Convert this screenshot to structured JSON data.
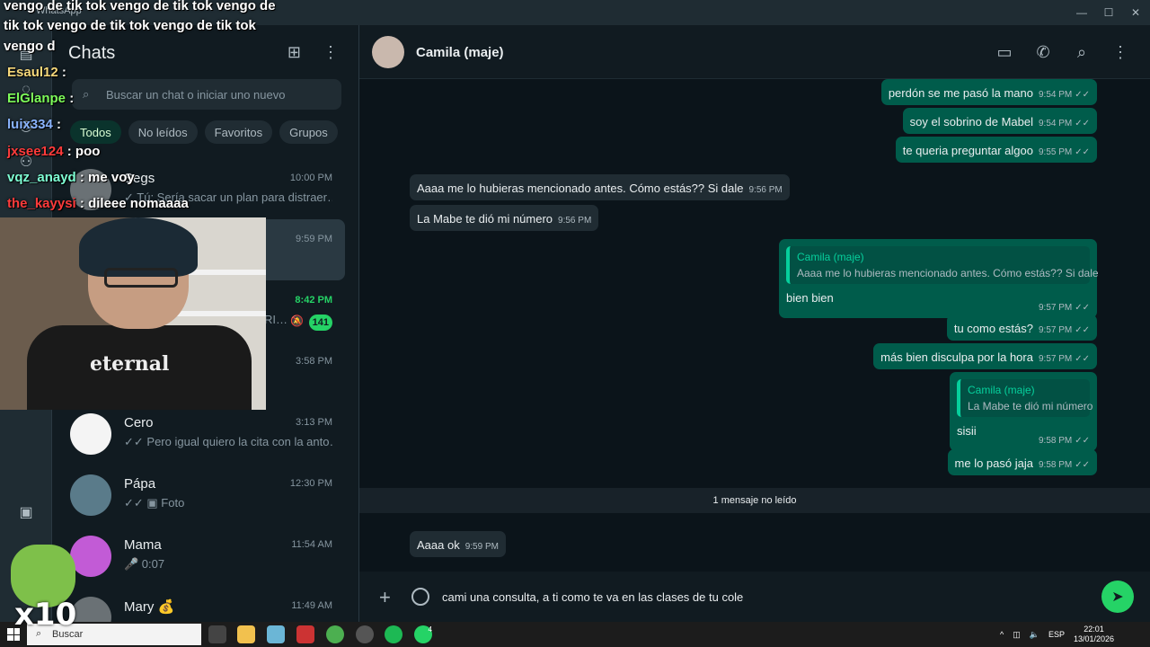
{
  "titlebar": {
    "app_name": "WhatsApp",
    "minimize": "—",
    "maximize": "☐",
    "close": "✕"
  },
  "chatlist": {
    "title": "Chats",
    "search_placeholder": "Buscar un chat o iniciar uno nuevo",
    "filters": [
      "Todos",
      "No leídos",
      "Favoritos",
      "Grupos"
    ],
    "items": [
      {
        "name": "Segs",
        "time": "10:00 PM",
        "preview": "✓ Tú: Sería sacar un plan para distraer…"
      },
      {
        "name": "",
        "time": "9:59 PM",
        "preview": ""
      },
      {
        "name": "",
        "time": "8:42 PM",
        "preview": "RI…",
        "badge": "141"
      },
      {
        "name": "",
        "time": "3:58 PM",
        "preview": ""
      },
      {
        "name": "Cero",
        "time": "3:13 PM",
        "preview": "✓✓ Pero igual quiero la cita con la anto…"
      },
      {
        "name": "Pápa",
        "time": "12:30 PM",
        "preview": "✓✓ ▣ Foto"
      },
      {
        "name": "Mama",
        "time": "11:54 AM",
        "preview": "🎤 0:07"
      },
      {
        "name": "Mary 💰",
        "time": "11:49 AM",
        "preview": ""
      }
    ]
  },
  "conversation": {
    "contact_name": "Camila (maje)",
    "messages": [
      {
        "dir": "out",
        "text": "perdón se me pasó la mano",
        "time": "9:54 PM"
      },
      {
        "dir": "out",
        "text": "soy el sobrino de Mabel",
        "time": "9:54 PM"
      },
      {
        "dir": "out",
        "text": "te queria preguntar algoo",
        "time": "9:55 PM"
      },
      {
        "dir": "in",
        "text": "Aaaa me lo hubieras mencionado antes. Cómo estás?? Si dale",
        "time": "9:56 PM"
      },
      {
        "dir": "in",
        "text": "La Mabe te dió mi número",
        "time": "9:56 PM"
      },
      {
        "dir": "out",
        "quote_name": "Camila (maje)",
        "quote_text": "Aaaa me lo hubieras mencionado antes. Cómo estás?? Si dale",
        "text": "bien bien",
        "time": "9:57 PM"
      },
      {
        "dir": "out",
        "text": "tu como estás?",
        "time": "9:57 PM"
      },
      {
        "dir": "out",
        "text": "más bien disculpa por la hora",
        "time": "9:57 PM"
      },
      {
        "dir": "out",
        "quote_name": "Camila (maje)",
        "quote_text": "La Mabe te dió mi número",
        "text": "sisii",
        "time": "9:58 PM"
      },
      {
        "dir": "out",
        "text": "me lo pasó jaja",
        "time": "9:58 PM"
      },
      {
        "dir": "in",
        "text": "Aaaa ok",
        "time": "9:59 PM"
      }
    ],
    "unread_divider": "1 mensaje no leído",
    "composer_text": "cami una consulta, a ti como te va en las clases de tu cole",
    "ticks": "✓✓"
  },
  "taskbar": {
    "search_label": "Buscar",
    "lang": "ESP",
    "clock_time": "22:01",
    "clock_date": "13/01/2026",
    "whatsapp_badge": "4"
  },
  "overlay": {
    "banner_lines": [
      "vengo de tik tok vengo de tik tok vengo de",
      "tik tok vengo de tik tok vengo de tik tok",
      "vengo d"
    ],
    "chat": [
      {
        "user": "Esaul12",
        "msg": "",
        "color": "#f5d77a"
      },
      {
        "user": "ElGlanpe",
        "msg": "",
        "color": "#7dfc5a"
      },
      {
        "user": "luix334",
        "msg": "",
        "color": "#8ab4ff"
      },
      {
        "user": "jxsee124",
        "msg": "poo",
        "color": "#ff3b3b"
      },
      {
        "user": "vqz_anayd",
        "msg": "me voy",
        "color": "#7fffd4"
      },
      {
        "user": "the_kayysi",
        "msg": "dileee nomaaaa",
        "color": "#ff3b3b"
      }
    ],
    "cam_shirt_text": "eternal",
    "emote_multiplier": "x10"
  }
}
